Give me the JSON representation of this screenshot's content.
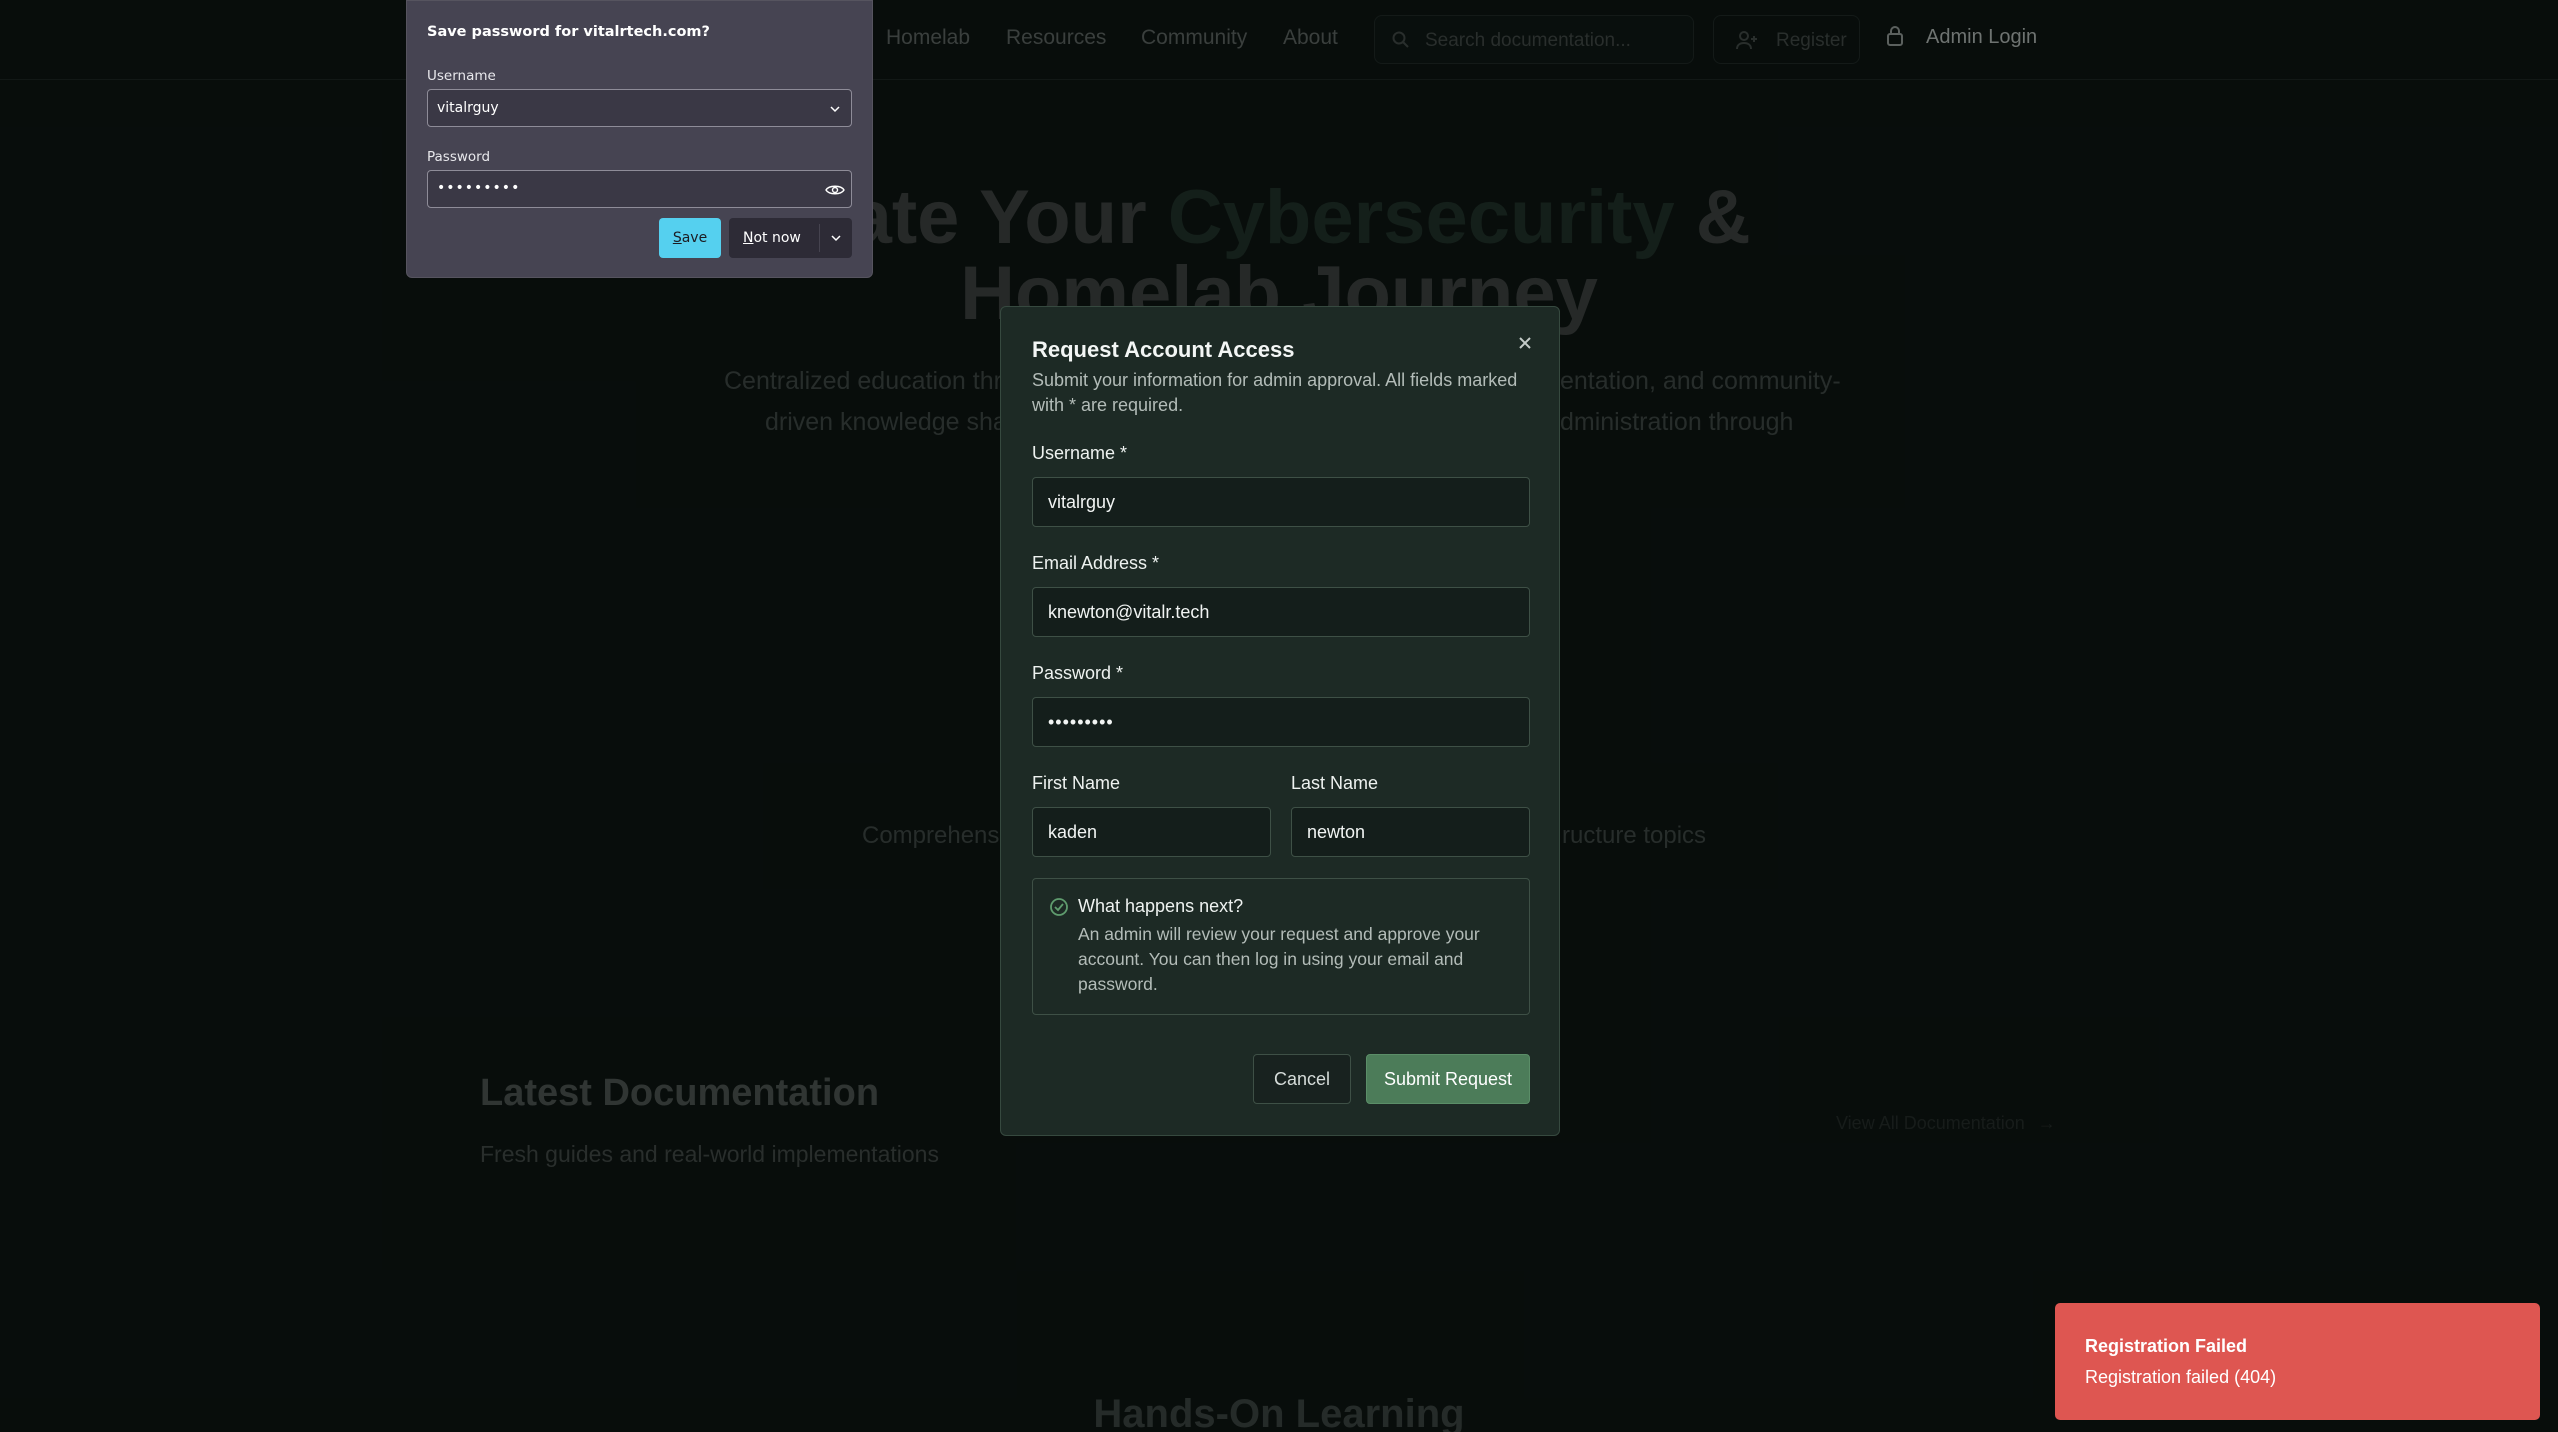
{
  "nav": {
    "links": [
      "Homelab",
      "Resources",
      "Community",
      "About"
    ],
    "search_placeholder": "Search documentation...",
    "register_label": "Register",
    "admin_login_label": "Admin Login"
  },
  "hero": {
    "title_line1_a": "vate Your ",
    "title_line1_accent": "Cybersecurity",
    "title_line1_b": " &",
    "title_line2": "Homelab Journey",
    "subtitle_left_1": "Centralized education thr",
    "subtitle_right_1": "entation, and community-",
    "subtitle_left_2": "driven knowledge sha",
    "subtitle_right_2": "dministration through"
  },
  "mid": {
    "left_text": "Comprehensi",
    "right_text": "ructure topics"
  },
  "latest": {
    "title": "Latest Documentation",
    "subtitle": "Fresh guides and real-world implementations",
    "view_all": "View All Documentation"
  },
  "hands_on_title": "Hands-On Learning",
  "modal": {
    "title": "Request Account Access",
    "description": "Submit your information for admin approval. All fields marked with * are required.",
    "username_label": "Username *",
    "username_value": "vitalrguy",
    "email_label": "Email Address *",
    "email_value": "knewton@vitalr.tech",
    "password_label": "Password *",
    "password_value": "•••••••••",
    "first_name_label": "First Name",
    "first_name_value": "kaden",
    "last_name_label": "Last Name",
    "last_name_value": "newton",
    "next_title": "What happens next?",
    "next_text": "An admin will review your request and approve your account. You can then log in using your email and password.",
    "cancel_label": "Cancel",
    "submit_label": "Submit Request"
  },
  "password_popup": {
    "title": "Save password for vitalrtech.com?",
    "username_label": "Username",
    "username_value": "vitalrguy",
    "password_label": "Password",
    "password_value": "•••••••••",
    "save_label_underlined": "S",
    "save_label_rest": "ave",
    "not_now_underlined": "N",
    "not_now_rest": "ot now"
  },
  "toast": {
    "title": "Registration Failed",
    "message": "Registration failed (404)"
  },
  "colors": {
    "background": "#0d1412",
    "modal_bg": "#1d2a25",
    "submit_button": "#4c7c59",
    "toast_bg": "#de5651",
    "popup_save": "#55d0ef",
    "popup_bg": "#464452"
  }
}
